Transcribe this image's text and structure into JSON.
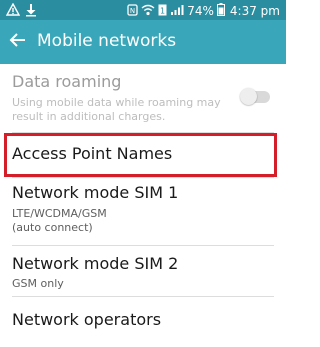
{
  "status_bar": {
    "battery_percent": "74%",
    "time": "4:37 pm",
    "icons": [
      "warning-icon",
      "download-icon",
      "nfc-icon",
      "wifi-icon",
      "sim-1-icon",
      "signal-icon",
      "battery-icon"
    ]
  },
  "app_bar": {
    "title": "Mobile networks",
    "back_icon": "arrow-left-icon"
  },
  "settings": [
    {
      "title": "Data roaming",
      "subtitle_lines": [
        "Using mobile data while roaming may",
        "result in additional charges."
      ],
      "enabled": false,
      "toggle": "off"
    },
    {
      "title": "Access Point Names",
      "highlighted": true,
      "highlight_color": "#d41e29"
    },
    {
      "title": "Network mode SIM 1",
      "subtitle_lines": [
        "LTE/WCDMA/GSM",
        "(auto connect)"
      ]
    },
    {
      "title": "Network mode SIM 2",
      "subtitle_lines": [
        "GSM only"
      ]
    },
    {
      "title": "Network operators"
    }
  ],
  "colors": {
    "status_bar": "#2a8ea0",
    "app_bar": "#39a7b9",
    "highlight": "#d41e29"
  }
}
